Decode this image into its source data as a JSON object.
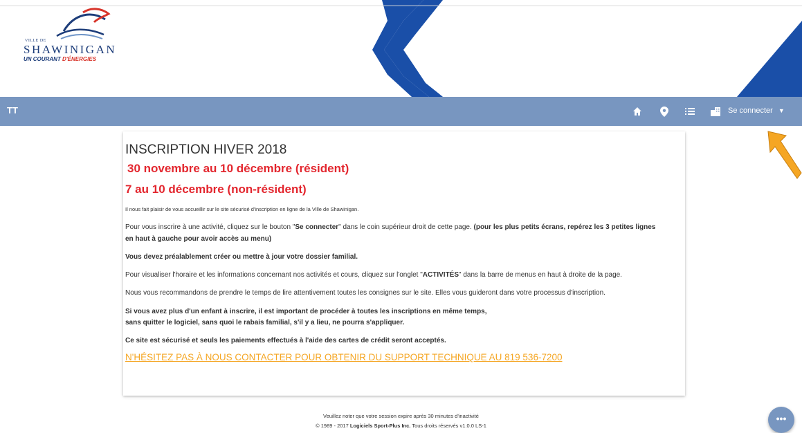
{
  "logo": {
    "ville": "VILLE DE",
    "name": "SHAWINIGAN",
    "slogan_part1": "UN COURANT ",
    "slogan_part2": "D'ÉNERGIES"
  },
  "navbar": {
    "font_size_icon": "TT",
    "icons": [
      "home-icon",
      "location-pin-icon",
      "list-icon",
      "city-icon"
    ],
    "login_label": "Se connecter",
    "login_caret": "▼",
    "color": "#7896c0"
  },
  "content": {
    "title": "INSCRIPTION HIVER 2018",
    "dates_resident": "30 novembre au 10 décembre (résident)",
    "dates_nonresident": "7 au 10 décembre (non-résident)",
    "welcome": "Il nous fait plaisir de vous accueillir sur le site sécurisé d'inscription en ligne de la Ville de Shawinigan.",
    "p1_a": "Pour vous inscrire à une activité, cliquez sur le bouton \"",
    "p1_b": "Se connecter",
    "p1_c": "\" dans le coin supérieur droit de cette page. ",
    "p1_d": "(pour les plus petits écrans, repérez les 3 petites lignes",
    "p1_e": "en haut à gauche pour avoir accès au menu)",
    "p2": "Vous devez préalablement créer ou mettre à jour votre dossier familial.",
    "p3_a": "Pour visualiser l'horaire et les informations concernant nos activités et cours, cliquez sur l'onglet \"",
    "p3_b": "ACTIVITÉS",
    "p3_c": "\" dans la barre de menus en haut à droite de la page.",
    "p4": "Nous vous recommandons de prendre le temps de lire attentivement toutes les consignes sur le site. Elles vous guideront dans votre processus d'inscription.",
    "p5_line1": "Si vous avez plus d'un enfant à inscrire, il est important de procéder à toutes les inscriptions en même temps,",
    "p5_line2": "sans quitter le logiciel, sans quoi le rabais familial, s'il y a lieu, ne pourra s'appliquer.",
    "p6": "Ce site est sécurisé et seuls les paiements effectués à l'aide des cartes de crédit seront acceptés.",
    "support_link": "N'HÉSITEZ PAS À NOUS CONTACTER POUR OBTENIR DU SUPPORT TECHNIQUE AU 819 536-7200"
  },
  "footer": {
    "session_note": "Veuillez noter que votre session expire après 30 minutes d'inactivité",
    "copyright_a": "© 1989 - 2017 ",
    "company": "Logiciels Sport-Plus Inc.",
    "copyright_b": " Tous droits réservés v1.0.0 LS-1"
  },
  "fab_label": "•••",
  "colors": {
    "accent_red": "#e3262e",
    "link_orange": "#f5a623",
    "banner_blue": "#1a4fa8"
  }
}
